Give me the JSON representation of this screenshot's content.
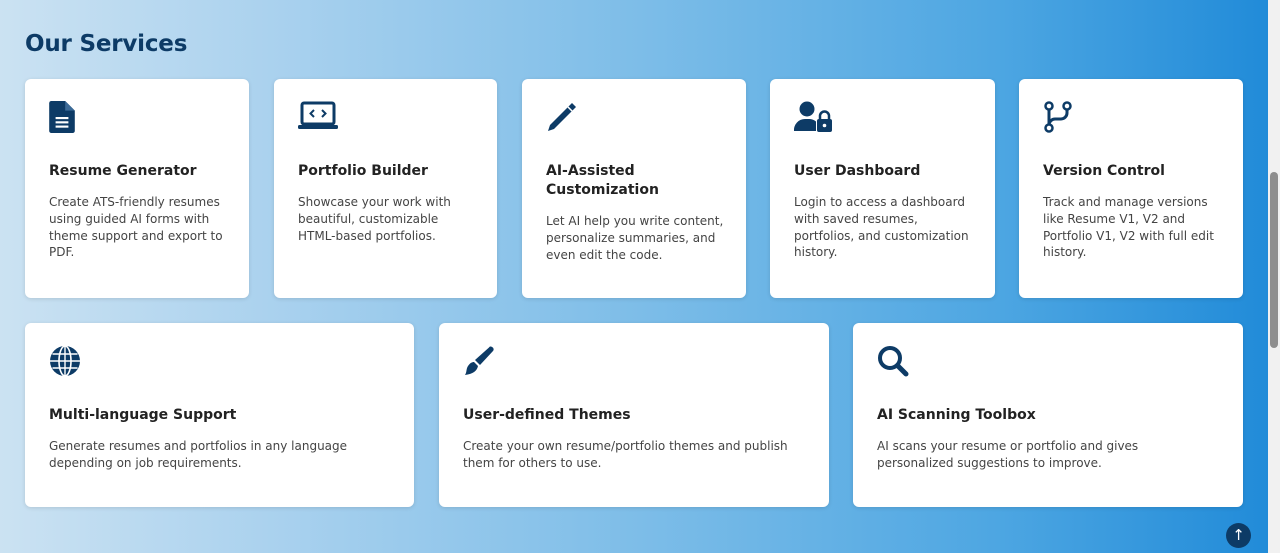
{
  "section": {
    "title": "Our Services"
  },
  "services": [
    {
      "icon": "document-icon",
      "title": "Resume Generator",
      "description": "Create ATS-friendly resumes using guided AI forms with theme support and export to PDF."
    },
    {
      "icon": "laptop-code-icon",
      "title": "Portfolio Builder",
      "description": "Showcase your work with beautiful, customizable HTML-based portfolios."
    },
    {
      "icon": "pen-icon",
      "title": "AI-Assisted Customization",
      "description": "Let AI help you write content, personalize summaries, and even edit the code."
    },
    {
      "icon": "user-lock-icon",
      "title": "User Dashboard",
      "description": "Login to access a dashboard with saved resumes, portfolios, and customization history."
    },
    {
      "icon": "code-branch-icon",
      "title": "Version Control",
      "description": "Track and manage versions like Resume V1, V2 and Portfolio V1, V2 with full edit history."
    },
    {
      "icon": "globe-icon",
      "title": "Multi-language Support",
      "description": "Generate resumes and portfolios in any language depending on job requirements."
    },
    {
      "icon": "paintbrush-icon",
      "title": "User-defined Themes",
      "description": "Create your own resume/portfolio themes and publish them for others to use."
    },
    {
      "icon": "search-icon",
      "title": "AI Scanning Toolbox",
      "description": "AI scans your resume or portfolio and gives personalized suggestions to improve."
    }
  ],
  "scroll_top": {
    "label": "↑",
    "icon": "arrow-up-icon"
  },
  "colors": {
    "primary": "#0d3b66",
    "card_background": "#ffffff",
    "gradient_start": "#cbe2f2",
    "gradient_end": "#1f8ad8"
  }
}
